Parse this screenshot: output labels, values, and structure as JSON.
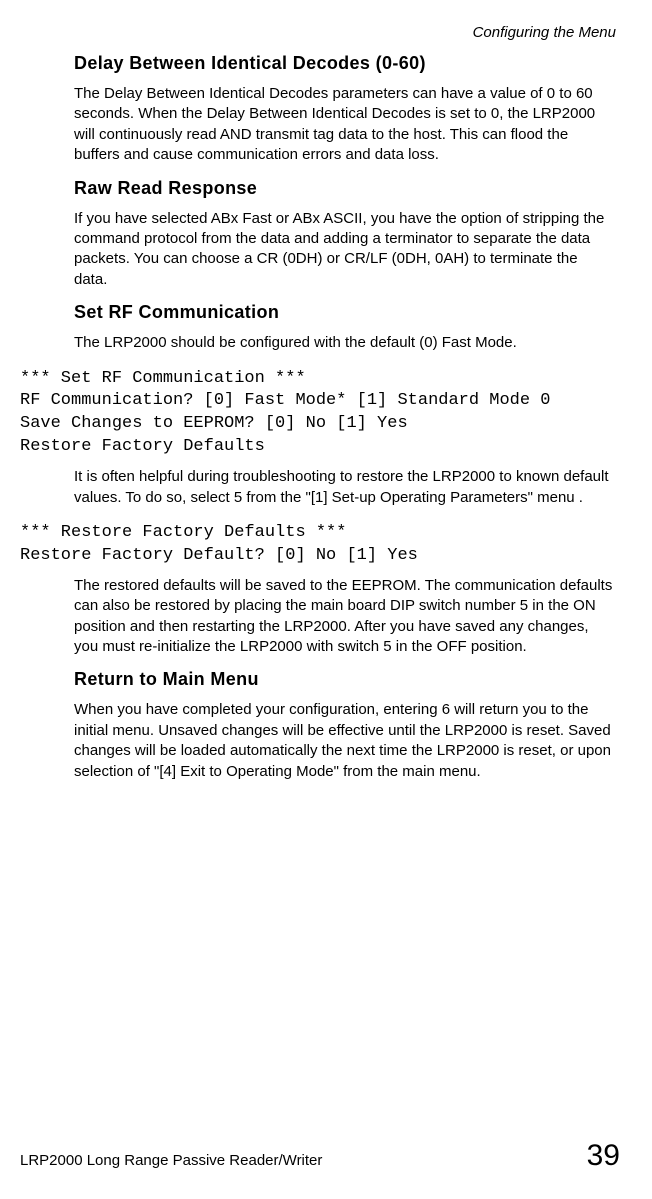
{
  "header": {
    "section_label": "Configuring the Menu"
  },
  "sections": {
    "delay": {
      "title": "Delay Between Identical Decodes (0-60)",
      "body": "The Delay Between Identical Decodes parameters can have a value of 0 to 60 seconds. When the Delay Between Identical Decodes is set to 0, the LRP2000 will continuously read AND transmit tag data to the host. This can flood the buffers and cause communication errors and data loss."
    },
    "raw_read": {
      "title": "Raw Read Response",
      "body": "If you have selected ABx Fast or ABx ASCII, you have the option of stripping the command protocol from the data and adding a terminator to separate the data packets. You can choose a CR (0DH) or CR/LF (0DH, 0AH) to terminate the data."
    },
    "set_rf": {
      "title": "Set RF Communication",
      "body": "The LRP2000 should be configured with the default (0) Fast Mode.",
      "code": "*** Set RF Communication ***\nRF Communication? [0] Fast Mode* [1] Standard Mode 0\nSave Changes to EEPROM? [0] No [1] Yes\nRestore Factory Defaults",
      "body2": "It is often helpful during troubleshooting to restore the LRP2000 to known default values. To do so, select 5 from the \"[1] Set-up Operating Parameters\" menu ."
    },
    "restore": {
      "code": "*** Restore Factory Defaults ***\nRestore Factory Default? [0] No [1] Yes",
      "body": "The restored defaults will be saved to the EEPROM. The communication defaults can also be restored by placing the main board DIP switch number 5 in the ON position and then restarting the LRP2000. After you have saved any changes, you must re-initialize the LRP2000 with switch 5 in the OFF position."
    },
    "return": {
      "title": "Return to Main Menu",
      "body": "When you have completed your configuration, entering 6 will return you to the initial menu. Unsaved changes will be effective until the LRP2000 is reset.  Saved changes will be loaded automatically the next time the LRP2000 is reset, or upon selection of \"[4] Exit to Operating Mode\" from the main menu."
    }
  },
  "footer": {
    "product": "LRP2000 Long Range Passive Reader/Writer",
    "page": "39"
  }
}
